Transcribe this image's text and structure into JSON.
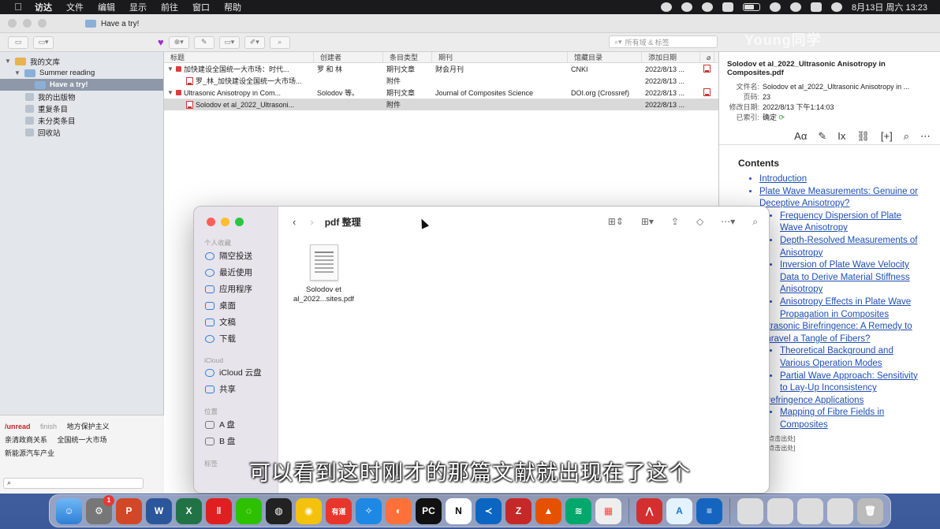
{
  "menubar": {
    "app_name": "访达",
    "items": [
      "文件",
      "编辑",
      "显示",
      "前往",
      "窗口",
      "帮助"
    ],
    "datetime": "8月13日 周六 13:23"
  },
  "zotero": {
    "tab_title": "Have a try!",
    "search_placeholder": "所有域 & 标签",
    "watermark": "Young同学",
    "tree": [
      {
        "label": "我的文库",
        "level": 0
      },
      {
        "label": "Summer reading",
        "level": 1
      },
      {
        "label": "Have a try!",
        "level": 2,
        "selected": true
      },
      {
        "label": "我的出版物",
        "level": 1
      },
      {
        "label": "重复条目",
        "level": 1
      },
      {
        "label": "未分类条目",
        "level": 1
      },
      {
        "label": "回收站",
        "level": 1
      }
    ],
    "tags": {
      "row1": [
        "/unread",
        "finish",
        "地方保护主义"
      ],
      "row2": [
        "亲清政商关系",
        "全国统一大市场"
      ],
      "row3": [
        "新能源汽车产业"
      ]
    },
    "columns": [
      "标题",
      "创建者",
      "条目类型",
      "期刊",
      "馆藏目录",
      "添加日期"
    ],
    "rows": [
      {
        "title": "加快建设全国统一大市场：时代...",
        "creator": "罗 和 林",
        "type": "期刊文章",
        "pub": "财会月刊",
        "catalog": "CNKI",
        "date": "2022/8/13 ..."
      },
      {
        "title": "罗_林_加快建设全国统一大市场...",
        "creator": "",
        "type": "附件",
        "pub": "",
        "catalog": "",
        "date": "2022/8/13 ..."
      },
      {
        "title": "Ultrasonic Anisotropy in Com...",
        "creator": "Solodov 等。",
        "type": "期刊文章",
        "pub": "Journal of Composites Science",
        "catalog": "DOI.org (Crossref)",
        "date": "2022/8/13 ..."
      },
      {
        "title": "Solodov et al_2022_Ultrasoni...",
        "creator": "",
        "type": "附件",
        "pub": "",
        "catalog": "",
        "date": "2022/8/13 ..."
      }
    ]
  },
  "detail": {
    "header": "Solodov et al_2022_Ultrasonic Anisotropy in Composites.pdf",
    "filename_label": "文件名:",
    "filename": "Solodov et al_2022_Ultrasonic Anisotropy in ...",
    "pages_label": "页码:",
    "pages": "23",
    "modified_label": "修改日期:",
    "modified": "2022/8/13 下午1:14:03",
    "indexed_label": "已索引:",
    "indexed": "确定",
    "contents_title": "Contents",
    "toc": [
      {
        "text": "Introduction",
        "level": 1
      },
      {
        "text": "Plate Wave Measurements: Genuine or Deceptive Anisotropy?",
        "level": 1
      },
      {
        "text": "Frequency Dispersion of Plate Wave Anisotropy",
        "level": 2
      },
      {
        "text": "Depth-Resolved Measurements of Anisotropy",
        "level": 2
      },
      {
        "text": "Inversion of Plate Wave Velocity Data to Derive Material Stiffness Anisotropy",
        "level": 2
      },
      {
        "text": "Anisotropy Effects in Plate Wave Propagation in Composites",
        "level": 2
      },
      {
        "text": "Ultrasonic Birefringence: A Remedy to Unravel a Tangle of Fibers?",
        "level": 1
      },
      {
        "text": "Theoretical Background and Various Operation Modes",
        "level": 2
      },
      {
        "text": "Partial Wave Approach: Sensitivity to Lay-Up Inconsistency",
        "level": 2
      },
      {
        "text": "Birefringence Applications",
        "level": 1
      },
      {
        "text": "Mapping of Fibre Fields in Composites",
        "level": 2
      }
    ],
    "footer1": "[点击出处]",
    "footer2": "[点击出处]"
  },
  "finder": {
    "title": "pdf 整理",
    "sections": [
      {
        "heading": "个人收藏",
        "items": [
          "隔空投送",
          "最近使用",
          "应用程序",
          "桌面",
          "文稿",
          "下载"
        ]
      },
      {
        "heading": "iCloud",
        "items": [
          "iCloud 云盘",
          "共享"
        ]
      },
      {
        "heading": "位置",
        "items": [
          "A 盘",
          "B 盘"
        ]
      },
      {
        "heading": "标签",
        "items": []
      }
    ],
    "file_name_line1": "Solodov et",
    "file_name_line2": "al_2022...sites.pdf"
  },
  "subtitle": "可以看到这时刚才的那篇文献就出现在了这个",
  "dock": {
    "badge_count": "1",
    "apps": [
      "Finder",
      "System Preferences",
      "PowerPoint",
      "Word",
      "Excel",
      "Baidu",
      "WeChat",
      "QQ",
      "Chrome",
      "Youdao",
      "Safari",
      "Firefox",
      "PyCharm",
      "Notion",
      "VS Code",
      "Zotero",
      "MATLAB",
      "Maps",
      "Launchpad",
      "Acrobat",
      "Xcode",
      "Mail"
    ],
    "youdao_label": "有道",
    "pc_label": "PC",
    "notion_label": "N"
  },
  "colors": {
    "accent_red": "#c1272d",
    "link_blue": "#1f4fb5",
    "selection_gray": "#8e98a8"
  }
}
